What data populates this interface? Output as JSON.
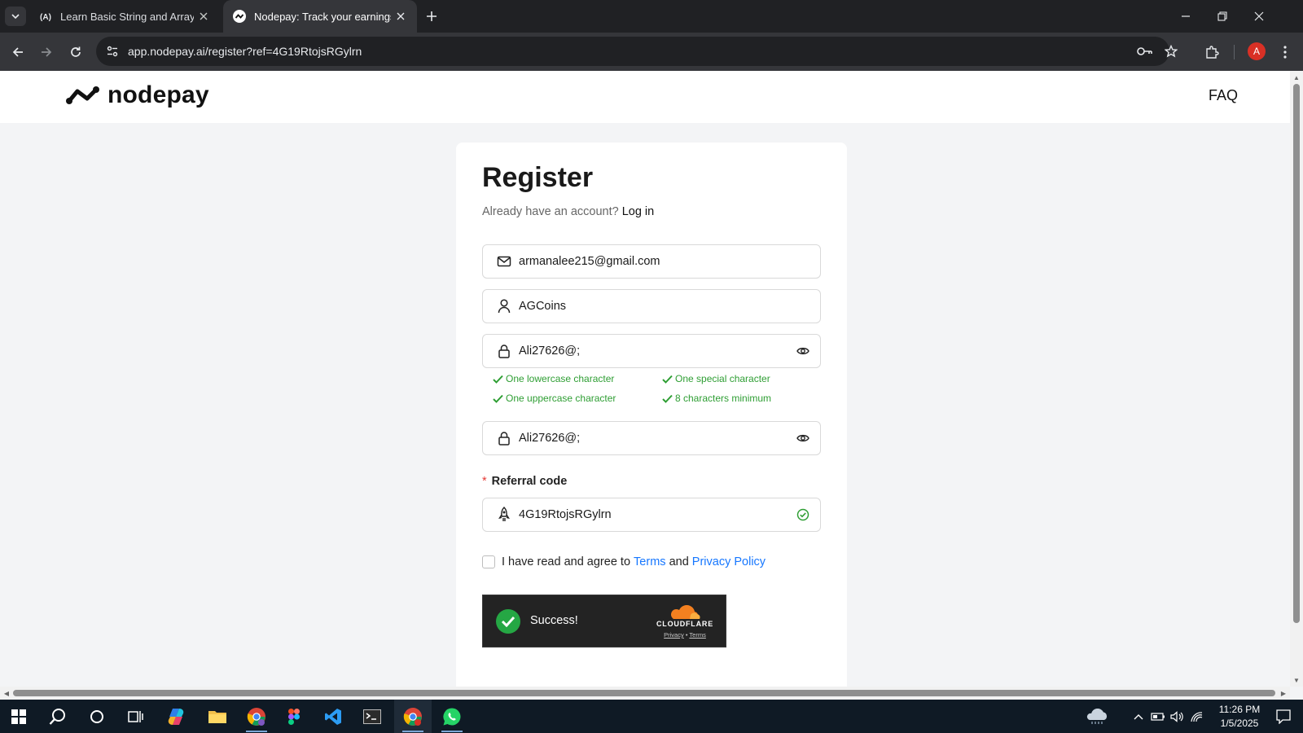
{
  "browser": {
    "tabs": [
      {
        "title": "Learn Basic String and Array Me",
        "favicon": "A"
      },
      {
        "title": "Nodepay: Track your earnings"
      }
    ],
    "url": "app.nodepay.ai/register?ref=4G19RtojsRGylrn",
    "profile_initial": "A"
  },
  "site": {
    "brand": "nodepay",
    "nav": {
      "faq": "FAQ"
    }
  },
  "form": {
    "title": "Register",
    "login_prompt": "Already have an account?",
    "login_link": "Log in",
    "email": "armanalee215@gmail.com",
    "username": "AGCoins",
    "password": "Ali27626@;",
    "confirm_password": "Ali27626@;",
    "rules": [
      "One lowercase character",
      "One special character",
      "One uppercase character",
      "8 characters minimum"
    ],
    "referral_label": "Referral code",
    "referral_required_mark": "*",
    "referral_code": "4G19RtojsRGylrn",
    "agree_prefix": "I have read and agree to",
    "terms": "Terms",
    "and": "and",
    "privacy": "Privacy Policy"
  },
  "captcha": {
    "status": "Success!",
    "brand": "CLOUDFLARE",
    "privacy": "Privacy",
    "sep": "•",
    "terms": "Terms"
  },
  "taskbar": {
    "time": "11:26 PM",
    "date": "1/5/2025"
  },
  "colors": {
    "rule_ok": "#2e9e33",
    "link": "#1677ff",
    "required": "#e53935",
    "cf_success": "#25a744"
  }
}
